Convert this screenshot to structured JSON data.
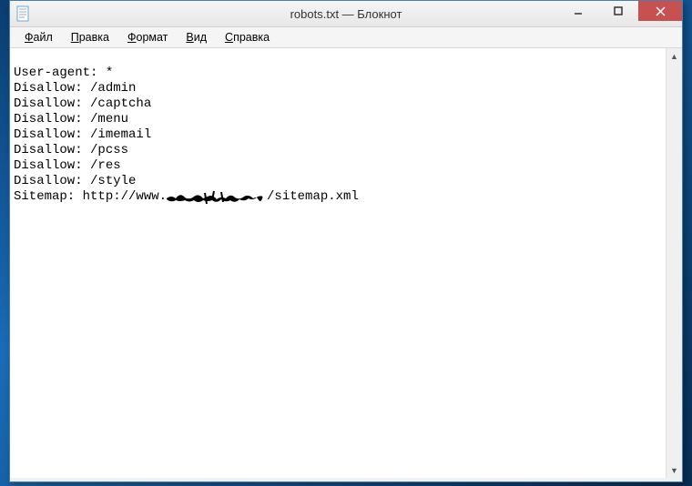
{
  "window": {
    "title": "robots.txt — Блокнот"
  },
  "menu": {
    "file": "Файл",
    "edit": "Правка",
    "format": "Формат",
    "view": "Вид",
    "help": "Справка"
  },
  "editor": {
    "lines": [
      "User-agent: *",
      "Disallow: /admin",
      "Disallow: /captcha",
      "Disallow: /menu",
      "Disallow: /imemail",
      "Disallow: /pcss",
      "Disallow: /res",
      "Disallow: /style"
    ],
    "sitemap_prefix": "Sitemap: http://www.",
    "sitemap_redacted": "██████████",
    "sitemap_suffix": "/sitemap.xml"
  }
}
